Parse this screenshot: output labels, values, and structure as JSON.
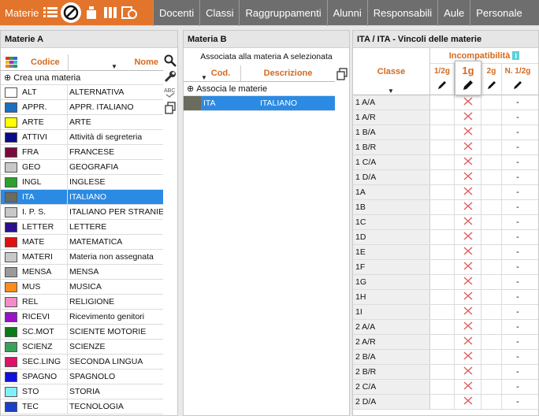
{
  "topbar": {
    "title": "Materie",
    "tabs": [
      "Docenti",
      "Classi",
      "Raggruppamenti",
      "Alunni",
      "Responsabili",
      "Aule",
      "Personale"
    ]
  },
  "panelA": {
    "title": "Materie A",
    "col_codice": "Codice",
    "col_nome": "Nome",
    "create": "Crea una materia",
    "rows": [
      {
        "color": "#ffffff",
        "code": "ALT",
        "name": "ALTERNATIVA"
      },
      {
        "color": "#1a6fbf",
        "code": "APPR.",
        "name": "APPR. ITALIANO"
      },
      {
        "color": "#ffff00",
        "code": "ARTE",
        "name": "ARTE"
      },
      {
        "color": "#0a0a8c",
        "code": "ATTIVI",
        "name": "Attività di segreteria"
      },
      {
        "color": "#7a0a3c",
        "code": "FRA",
        "name": "FRANCESE"
      },
      {
        "color": "#c8c8c8",
        "code": "GEO",
        "name": "GEOGRAFIA"
      },
      {
        "color": "#2ca02c",
        "code": "INGL",
        "name": "INGLESE"
      },
      {
        "color": "#6b6b5e",
        "code": "ITA",
        "name": "ITALIANO"
      },
      {
        "color": "#c8c8c8",
        "code": "I. P. S.",
        "name": "ITALIANO PER STRANIERI"
      },
      {
        "color": "#2a1090",
        "code": "LETTER",
        "name": "LETTERE"
      },
      {
        "color": "#e01010",
        "code": "MATE",
        "name": "MATEMATICA"
      },
      {
        "color": "#c8c8c8",
        "code": "MATERI",
        "name": "Materia non assegnata"
      },
      {
        "color": "#9a9a9a",
        "code": "MENSA",
        "name": "MENSA"
      },
      {
        "color": "#ff8c1a",
        "code": "MUS",
        "name": "MUSICA"
      },
      {
        "color": "#f48cc8",
        "code": "REL",
        "name": "RELIGIONE"
      },
      {
        "color": "#9b10c8",
        "code": "RICEVI",
        "name": "Ricevimento genitori"
      },
      {
        "color": "#0b7a1a",
        "code": "SC.MOT",
        "name": "SCIENTE MOTORIE"
      },
      {
        "color": "#3aa05a",
        "code": "SCIENZ",
        "name": "SCIENZE"
      },
      {
        "color": "#e0106a",
        "code": "SEC.LING",
        "name": "SECONDA LINGUA"
      },
      {
        "color": "#1010e0",
        "code": "SPAGNO",
        "name": "SPAGNOLO"
      },
      {
        "color": "#7ff0f8",
        "code": "STO",
        "name": "STORIA"
      },
      {
        "color": "#1a40c8",
        "code": "TEC",
        "name": "TECNOLOGIA"
      }
    ]
  },
  "panelB": {
    "title": "Materia B",
    "subtitle": "Associata alla materia A selezionata",
    "col_cod": "Cod.",
    "col_desc": "Descrizione",
    "assoc": "Associa le materie",
    "row": {
      "color": "#6b6b5e",
      "code": "ITA",
      "name": "ITALIANO"
    }
  },
  "panelC": {
    "title": "ITA / ITA - Vincoli delle materie",
    "col_classe": "Classe",
    "incompat": "Incompatibilità",
    "cols": [
      "1/2g",
      "1g",
      "2g",
      "N. 1/2g"
    ],
    "rows": [
      "1 A/A",
      "1 A/R",
      "1 B/A",
      "1 B/R",
      "1 C/A",
      "1 D/A",
      "1A",
      "1B",
      "1C",
      "1D",
      "1E",
      "1F",
      "1G",
      "1H",
      "1I",
      "2 A/A",
      "2 A/R",
      "2 B/A",
      "2 B/R",
      "2 C/A",
      "2 D/A"
    ],
    "dash": "-"
  }
}
